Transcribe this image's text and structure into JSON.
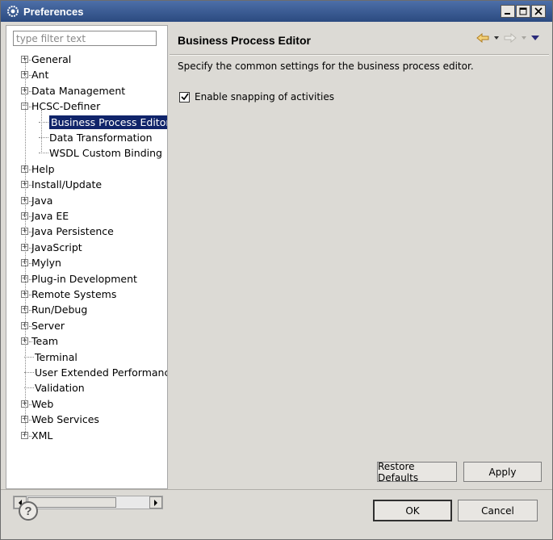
{
  "window": {
    "title": "Preferences"
  },
  "filter": {
    "placeholder": "type filter text",
    "value": ""
  },
  "tree": {
    "items": [
      {
        "label": "General",
        "expander": "+"
      },
      {
        "label": "Ant",
        "expander": "+"
      },
      {
        "label": "Data Management",
        "expander": "+"
      },
      {
        "label": "HCSC-Definer",
        "expander": "-"
      },
      {
        "label": "Business Process Editor",
        "child": true,
        "selected": true
      },
      {
        "label": "Data Transformation",
        "child": true
      },
      {
        "label": "WSDL Custom Binding",
        "child": true
      },
      {
        "label": "Help",
        "expander": "+"
      },
      {
        "label": "Install/Update",
        "expander": "+"
      },
      {
        "label": "Java",
        "expander": "+"
      },
      {
        "label": "Java EE",
        "expander": "+"
      },
      {
        "label": "Java Persistence",
        "expander": "+"
      },
      {
        "label": "JavaScript",
        "expander": "+"
      },
      {
        "label": "Mylyn",
        "expander": "+"
      },
      {
        "label": "Plug-in Development",
        "expander": "+"
      },
      {
        "label": "Remote Systems",
        "expander": "+"
      },
      {
        "label": "Run/Debug",
        "expander": "+"
      },
      {
        "label": "Server",
        "expander": "+"
      },
      {
        "label": "Team",
        "expander": "+"
      },
      {
        "label": "Terminal"
      },
      {
        "label": "User Extended Performance"
      },
      {
        "label": "Validation"
      },
      {
        "label": "Web",
        "expander": "+"
      },
      {
        "label": "Web Services",
        "expander": "+"
      },
      {
        "label": "XML",
        "expander": "+"
      }
    ]
  },
  "page": {
    "title": "Business Process Editor",
    "description": "Specify the common settings for the business process editor.",
    "checkbox_label": "Enable snapping of activities",
    "checkbox_checked": true
  },
  "buttons": {
    "restore_defaults": "Restore Defaults",
    "apply": "Apply",
    "ok": "OK",
    "cancel": "Cancel"
  },
  "icons": {
    "back": "back-arrow-icon",
    "forward": "forward-arrow-icon",
    "menu": "view-menu-icon",
    "help": "help-icon"
  },
  "colors": {
    "title_bar": "#2b4a80",
    "selection": "#10246a"
  }
}
